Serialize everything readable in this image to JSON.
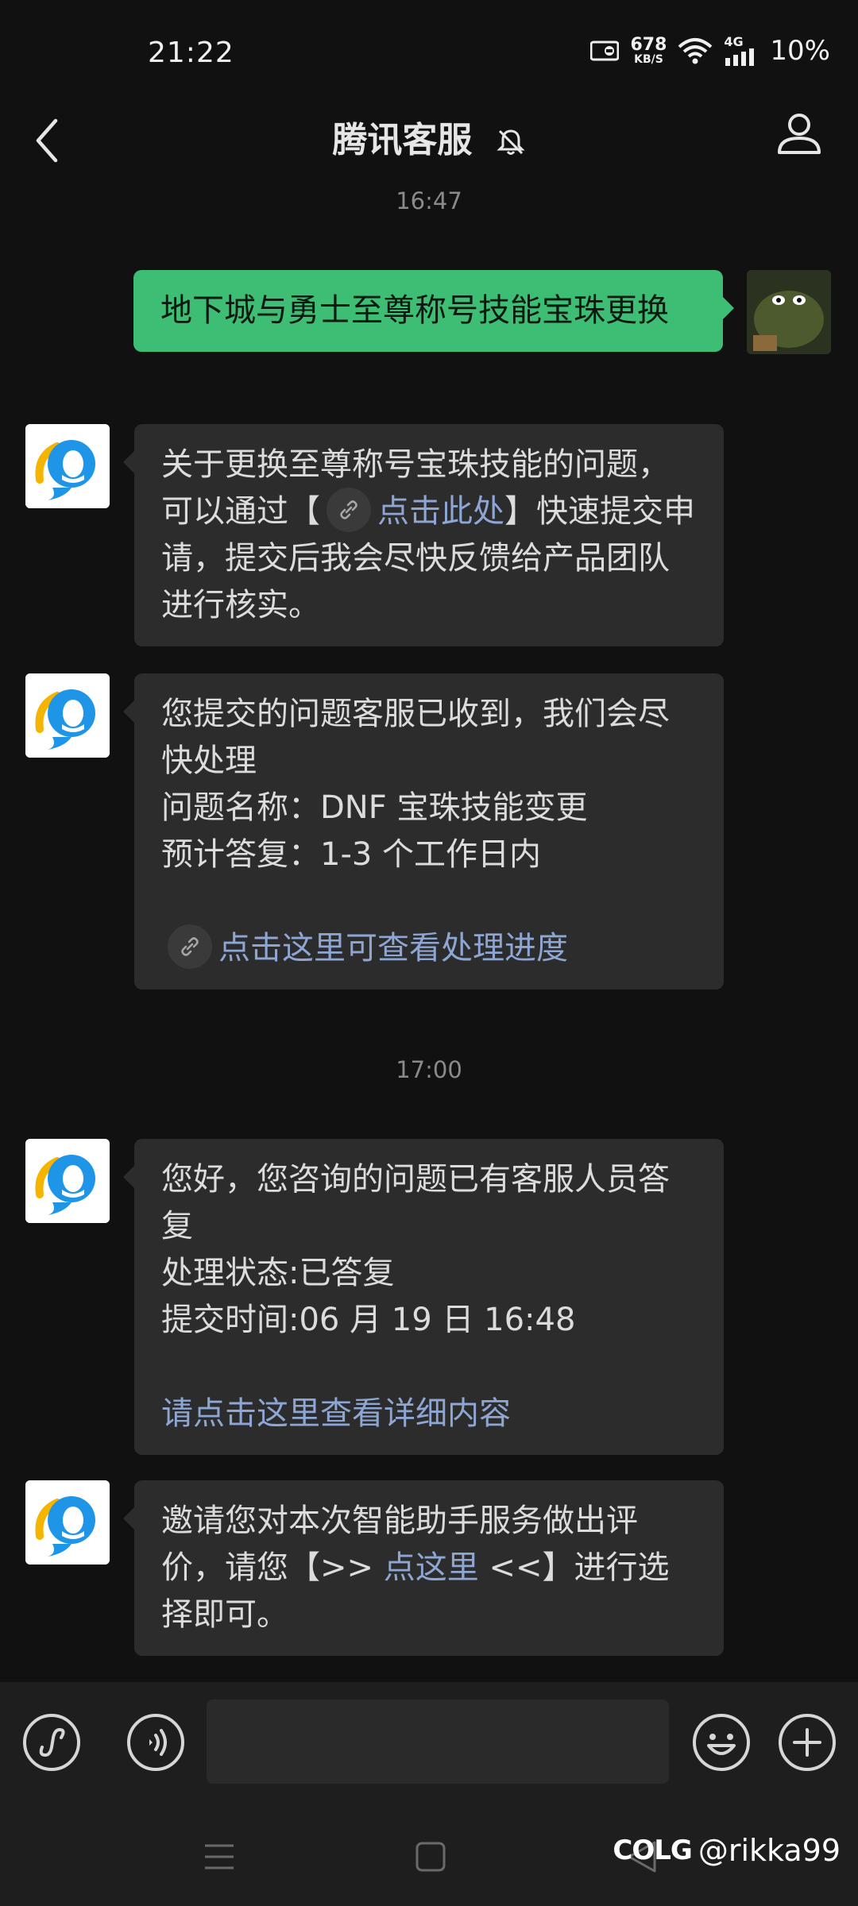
{
  "status": {
    "time": "21:22",
    "speed_value": "678",
    "speed_unit": "KB/S",
    "network": "4G",
    "battery": "10%"
  },
  "header": {
    "title": "腾讯客服"
  },
  "messages": [
    {
      "timestamp": "16:47"
    },
    {
      "from": "me",
      "text": "地下城与勇士至尊称号技能宝珠更换"
    },
    {
      "from": "bot",
      "before": "关于更换至尊称号宝珠技能的问题，可以通过【",
      "link": "点击此处",
      "after": "】快速提交申请，提交后我会尽快反馈给产品团队进行核实。"
    },
    {
      "from": "bot",
      "line1": "您提交的问题客服已收到，我们会尽快处理",
      "line2": "问题名称：DNF 宝珠技能变更",
      "line3": "预计答复：1-3 个工作日内",
      "link": "点击这里可查看处理进度"
    },
    {
      "timestamp": "17:00"
    },
    {
      "from": "bot",
      "line1": "您好，您咨询的问题已有客服人员答复",
      "line2": "处理状态:已答复",
      "line3": "提交时间:06 月 19 日 16:48",
      "link": "请点击这里查看详细内容"
    },
    {
      "from": "bot",
      "before": "邀请您对本次智能助手服务做出评价，请您【>> ",
      "link": "点这里",
      "after": " <<】进行选择即可。"
    }
  ],
  "watermark": {
    "logo": "COLG",
    "handle": "@rikka99"
  }
}
